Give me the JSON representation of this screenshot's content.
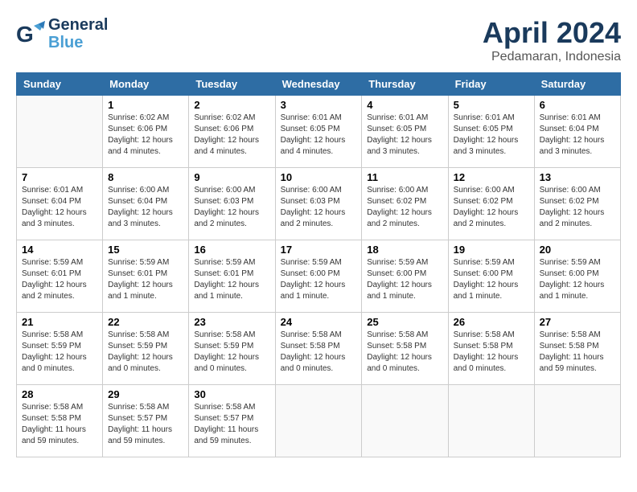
{
  "header": {
    "logo_line1": "General",
    "logo_line2": "Blue",
    "month": "April 2024",
    "location": "Pedamaran, Indonesia"
  },
  "weekdays": [
    "Sunday",
    "Monday",
    "Tuesday",
    "Wednesday",
    "Thursday",
    "Friday",
    "Saturday"
  ],
  "weeks": [
    [
      {
        "day": "",
        "info": ""
      },
      {
        "day": "1",
        "info": "Sunrise: 6:02 AM\nSunset: 6:06 PM\nDaylight: 12 hours\nand 4 minutes."
      },
      {
        "day": "2",
        "info": "Sunrise: 6:02 AM\nSunset: 6:06 PM\nDaylight: 12 hours\nand 4 minutes."
      },
      {
        "day": "3",
        "info": "Sunrise: 6:01 AM\nSunset: 6:05 PM\nDaylight: 12 hours\nand 4 minutes."
      },
      {
        "day": "4",
        "info": "Sunrise: 6:01 AM\nSunset: 6:05 PM\nDaylight: 12 hours\nand 3 minutes."
      },
      {
        "day": "5",
        "info": "Sunrise: 6:01 AM\nSunset: 6:05 PM\nDaylight: 12 hours\nand 3 minutes."
      },
      {
        "day": "6",
        "info": "Sunrise: 6:01 AM\nSunset: 6:04 PM\nDaylight: 12 hours\nand 3 minutes."
      }
    ],
    [
      {
        "day": "7",
        "info": "Sunrise: 6:01 AM\nSunset: 6:04 PM\nDaylight: 12 hours\nand 3 minutes."
      },
      {
        "day": "8",
        "info": "Sunrise: 6:00 AM\nSunset: 6:04 PM\nDaylight: 12 hours\nand 3 minutes."
      },
      {
        "day": "9",
        "info": "Sunrise: 6:00 AM\nSunset: 6:03 PM\nDaylight: 12 hours\nand 2 minutes."
      },
      {
        "day": "10",
        "info": "Sunrise: 6:00 AM\nSunset: 6:03 PM\nDaylight: 12 hours\nand 2 minutes."
      },
      {
        "day": "11",
        "info": "Sunrise: 6:00 AM\nSunset: 6:02 PM\nDaylight: 12 hours\nand 2 minutes."
      },
      {
        "day": "12",
        "info": "Sunrise: 6:00 AM\nSunset: 6:02 PM\nDaylight: 12 hours\nand 2 minutes."
      },
      {
        "day": "13",
        "info": "Sunrise: 6:00 AM\nSunset: 6:02 PM\nDaylight: 12 hours\nand 2 minutes."
      }
    ],
    [
      {
        "day": "14",
        "info": "Sunrise: 5:59 AM\nSunset: 6:01 PM\nDaylight: 12 hours\nand 2 minutes."
      },
      {
        "day": "15",
        "info": "Sunrise: 5:59 AM\nSunset: 6:01 PM\nDaylight: 12 hours\nand 1 minute."
      },
      {
        "day": "16",
        "info": "Sunrise: 5:59 AM\nSunset: 6:01 PM\nDaylight: 12 hours\nand 1 minute."
      },
      {
        "day": "17",
        "info": "Sunrise: 5:59 AM\nSunset: 6:00 PM\nDaylight: 12 hours\nand 1 minute."
      },
      {
        "day": "18",
        "info": "Sunrise: 5:59 AM\nSunset: 6:00 PM\nDaylight: 12 hours\nand 1 minute."
      },
      {
        "day": "19",
        "info": "Sunrise: 5:59 AM\nSunset: 6:00 PM\nDaylight: 12 hours\nand 1 minute."
      },
      {
        "day": "20",
        "info": "Sunrise: 5:59 AM\nSunset: 6:00 PM\nDaylight: 12 hours\nand 1 minute."
      }
    ],
    [
      {
        "day": "21",
        "info": "Sunrise: 5:58 AM\nSunset: 5:59 PM\nDaylight: 12 hours\nand 0 minutes."
      },
      {
        "day": "22",
        "info": "Sunrise: 5:58 AM\nSunset: 5:59 PM\nDaylight: 12 hours\nand 0 minutes."
      },
      {
        "day": "23",
        "info": "Sunrise: 5:58 AM\nSunset: 5:59 PM\nDaylight: 12 hours\nand 0 minutes."
      },
      {
        "day": "24",
        "info": "Sunrise: 5:58 AM\nSunset: 5:58 PM\nDaylight: 12 hours\nand 0 minutes."
      },
      {
        "day": "25",
        "info": "Sunrise: 5:58 AM\nSunset: 5:58 PM\nDaylight: 12 hours\nand 0 minutes."
      },
      {
        "day": "26",
        "info": "Sunrise: 5:58 AM\nSunset: 5:58 PM\nDaylight: 12 hours\nand 0 minutes."
      },
      {
        "day": "27",
        "info": "Sunrise: 5:58 AM\nSunset: 5:58 PM\nDaylight: 11 hours\nand 59 minutes."
      }
    ],
    [
      {
        "day": "28",
        "info": "Sunrise: 5:58 AM\nSunset: 5:58 PM\nDaylight: 11 hours\nand 59 minutes."
      },
      {
        "day": "29",
        "info": "Sunrise: 5:58 AM\nSunset: 5:57 PM\nDaylight: 11 hours\nand 59 minutes."
      },
      {
        "day": "30",
        "info": "Sunrise: 5:58 AM\nSunset: 5:57 PM\nDaylight: 11 hours\nand 59 minutes."
      },
      {
        "day": "",
        "info": ""
      },
      {
        "day": "",
        "info": ""
      },
      {
        "day": "",
        "info": ""
      },
      {
        "day": "",
        "info": ""
      }
    ]
  ]
}
